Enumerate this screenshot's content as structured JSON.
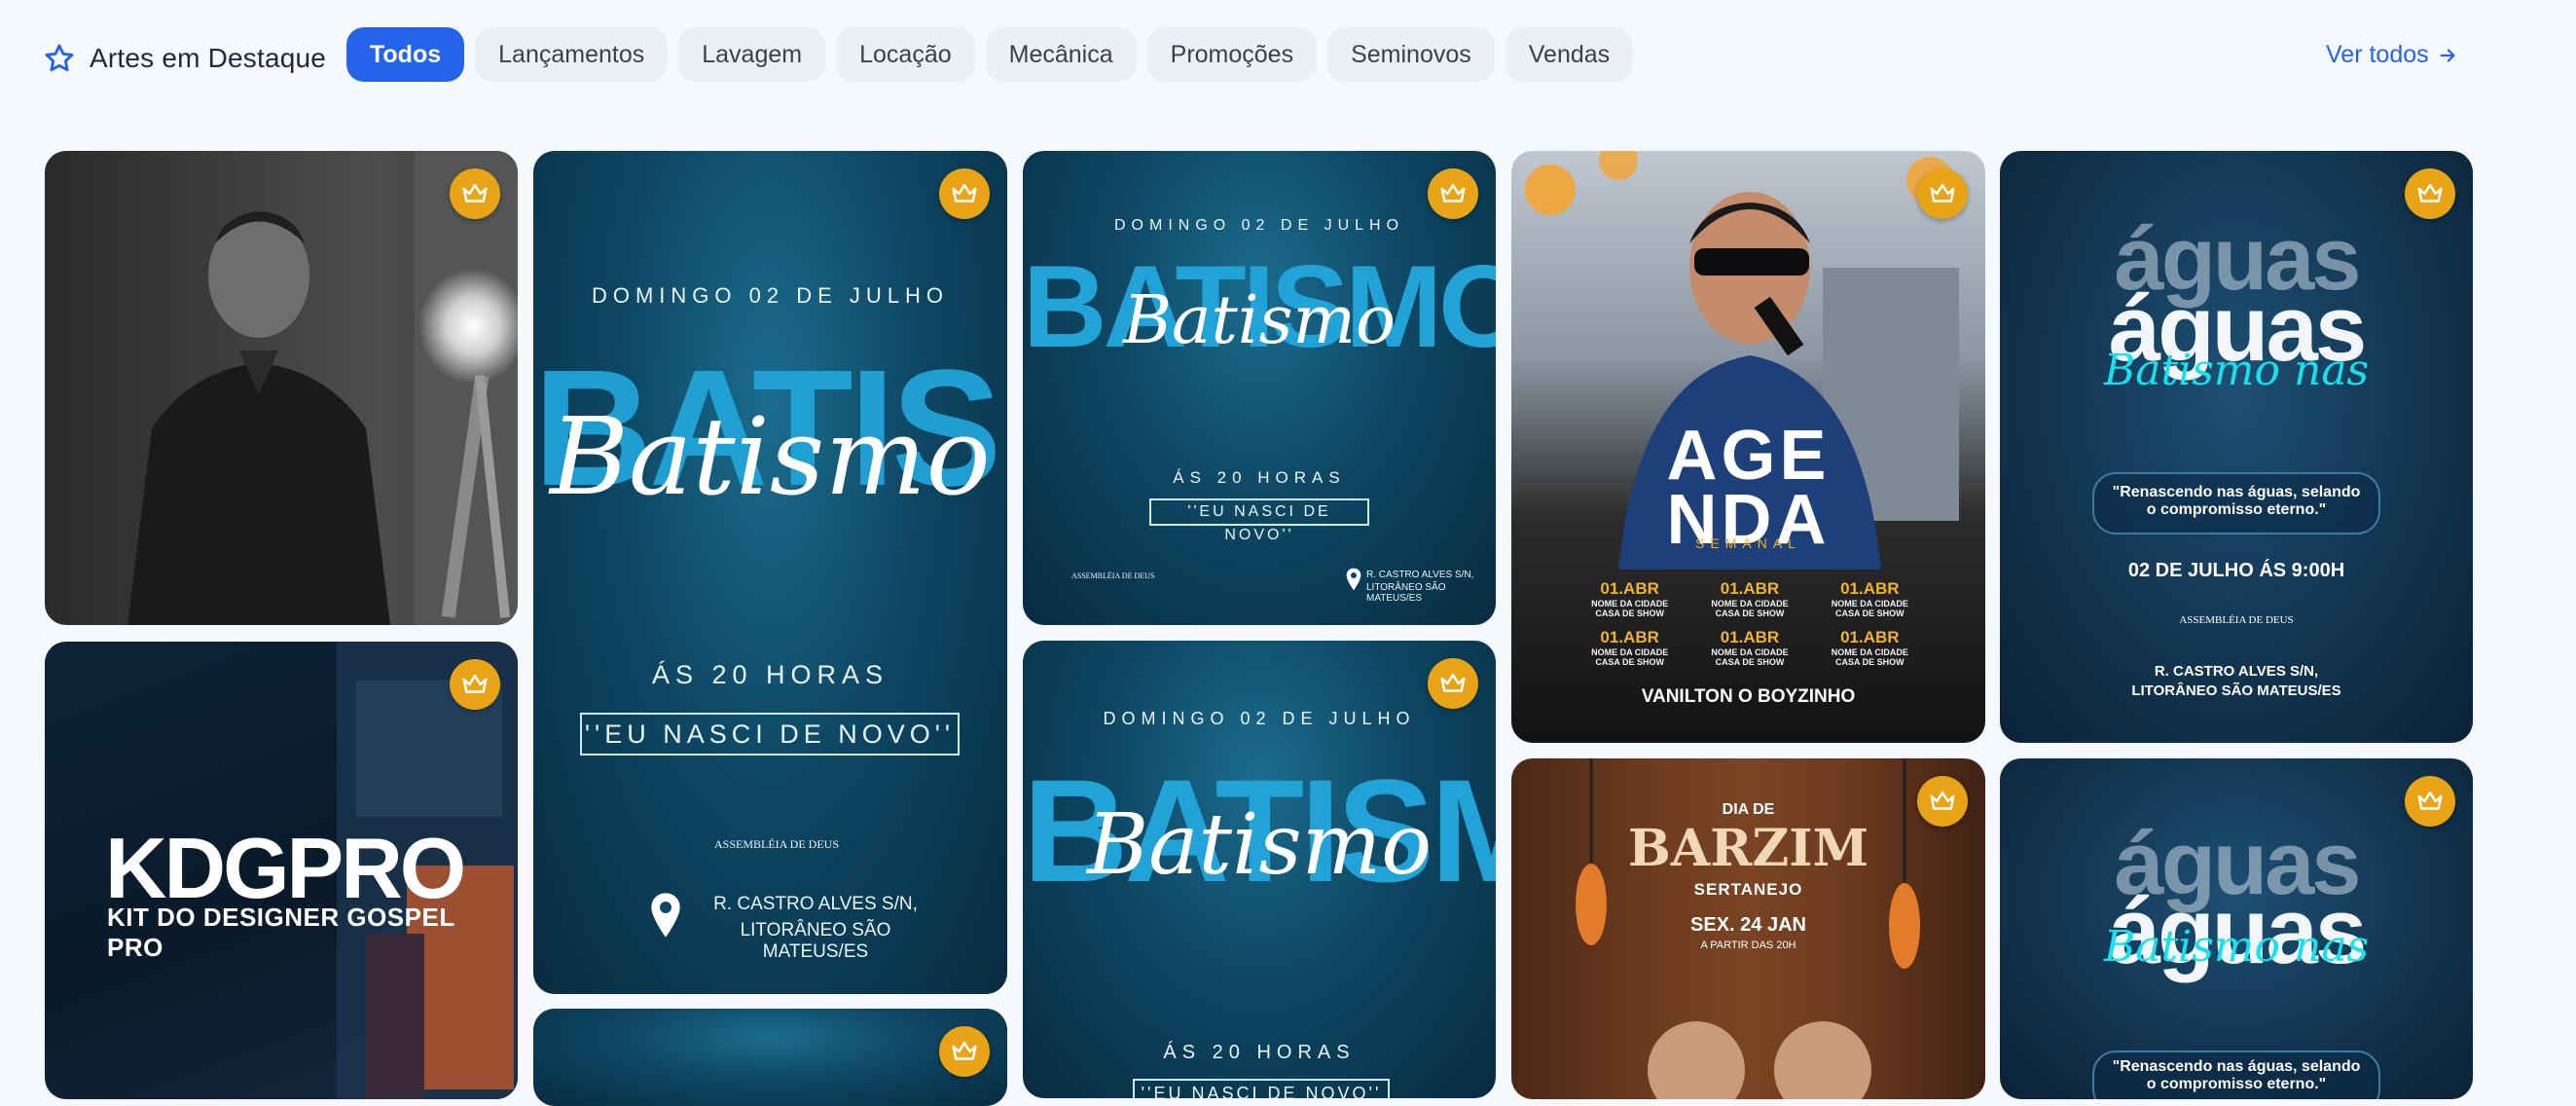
{
  "header": {
    "title": "Artes em Destaque",
    "see_all": "Ver todos",
    "chips": [
      "Todos",
      "Lançamentos",
      "Lavagem",
      "Locação",
      "Mecânica",
      "Promoções",
      "Seminovos",
      "Vendas"
    ],
    "active_chip": "Todos"
  },
  "icons": {
    "title": "star-outline-icon",
    "see_all": "arrow-right-icon",
    "premium": "crown-icon",
    "location": "map-pin-icon"
  },
  "colors": {
    "accent": "#2563eb",
    "premium": "#e8a317"
  },
  "cards": {
    "kdg": {
      "brand": "KDGPRO",
      "tagline": "KIT DO DESIGNER GOSPEL PRO"
    },
    "batismo_large": {
      "date": "DOMINGO 02 DE JULHO",
      "block": "BATISMO",
      "script": "Batismo",
      "time": "ÁS 20 HORAS",
      "quote": "''EU NASCI DE NOVO''",
      "church": "ASSEMBLÉIA DE DEUS",
      "address_line1": "R. CASTRO ALVES S/N,",
      "address_line2": "LITORÂNEO SÃO MATEUS/ES"
    },
    "batismo_small": {
      "date": "DOMINGO 02 DE JULHO",
      "block": "BATISMO",
      "script": "Batismo",
      "time": "ÁS 20 HORAS",
      "quote": "''EU NASCI DE NOVO''",
      "church": "ASSEMBLÉIA DE DEUS",
      "address_line1": "R. CASTRO ALVES S/N,",
      "address_line2": "LITORÂNEO SÃO MATEUS/ES"
    },
    "batismo_small2": {
      "date": "DOMINGO 02 DE JULHO",
      "block": "BATISMO",
      "script": "Batismo",
      "time": "ÁS 20 HORAS",
      "quote": "''EU NASCI DE NOVO''"
    },
    "agenda": {
      "title_line1": "AGE",
      "title_line2": "NDA",
      "subtitle": "SEMANAL",
      "date": "01.ABR",
      "place": "NOME DA CIDADE",
      "venue": "CASA DE SHOW",
      "artist": "VANILTON O BOYZINHO"
    },
    "aguas": {
      "word": "águas",
      "script": "Batismo nas",
      "quote_line1": "\"Renascendo nas águas, selando",
      "quote_line2": "o compromisso eterno.\"",
      "date": "02 DE JULHO ÁS 9:00H",
      "church": "ASSEMBLÉIA DE DEUS",
      "address_line1": "R. CASTRO ALVES S/N,",
      "address_line2": "LITORÂNEO SÃO MATEUS/ES"
    },
    "barzim": {
      "pre": "DIA DE",
      "title": "BARZIM",
      "style": "SERTANEJO",
      "date": "SEX. 24 JAN",
      "time": "A PARTIR DAS 20H"
    },
    "aguas2": {
      "word": "águas",
      "script": "Batismo nas",
      "quote_line1": "\"Renascendo nas águas, selando",
      "quote_line2": "o compromisso eterno.\""
    }
  }
}
